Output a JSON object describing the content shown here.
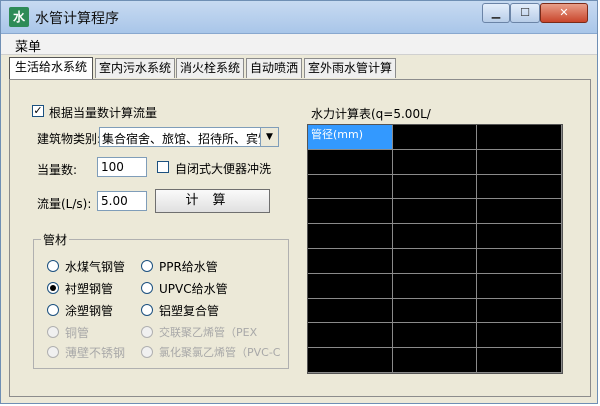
{
  "window": {
    "title": "水管计算程序",
    "app_icon": "faucet-icon"
  },
  "menu": {
    "items": [
      "菜单"
    ]
  },
  "tabs": [
    "生活给水系统",
    "室内污水系统",
    "消火栓系统",
    "自动喷洒",
    "室外雨水管计算"
  ],
  "active_tab": 0,
  "form": {
    "calc_by_fixture_label": "根据当量数计算流量",
    "calc_by_fixture_checked": true,
    "building_type_label": "建筑物类别:",
    "building_type_value": "集合宿舍、旅馆、招待所、宾馆",
    "fixture_count_label": "当量数:",
    "fixture_count_value": "100",
    "flush_valve_label": "自闭式大便器冲洗",
    "flush_valve_checked": false,
    "flow_label": "流量(L/s):",
    "flow_value": "5.00",
    "calc_button": "计算"
  },
  "pipe_material": {
    "title": "管材",
    "options": [
      {
        "label": "水煤气钢管",
        "selected": false,
        "enabled": true
      },
      {
        "label": "PPR给水管",
        "selected": false,
        "enabled": true
      },
      {
        "label": "衬塑钢管",
        "selected": true,
        "enabled": true
      },
      {
        "label": "UPVC给水管",
        "selected": false,
        "enabled": true
      },
      {
        "label": "涂塑钢管",
        "selected": false,
        "enabled": true
      },
      {
        "label": "铝塑复合管",
        "selected": false,
        "enabled": true
      },
      {
        "label": "铜管",
        "selected": false,
        "enabled": false
      },
      {
        "label": "交联聚乙烯管（PEX",
        "selected": false,
        "enabled": false
      },
      {
        "label": "薄壁不锈钢",
        "selected": false,
        "enabled": false
      },
      {
        "label": "氯化聚氯乙烯管（PVC-C",
        "selected": false,
        "enabled": false
      }
    ]
  },
  "results": {
    "title": "水力计算表(q=5.00L/",
    "header_first_cell": "管径(mm)",
    "columns": 3,
    "rows": 10,
    "header_color": "#3399ff",
    "grid_bg": "#000000"
  }
}
